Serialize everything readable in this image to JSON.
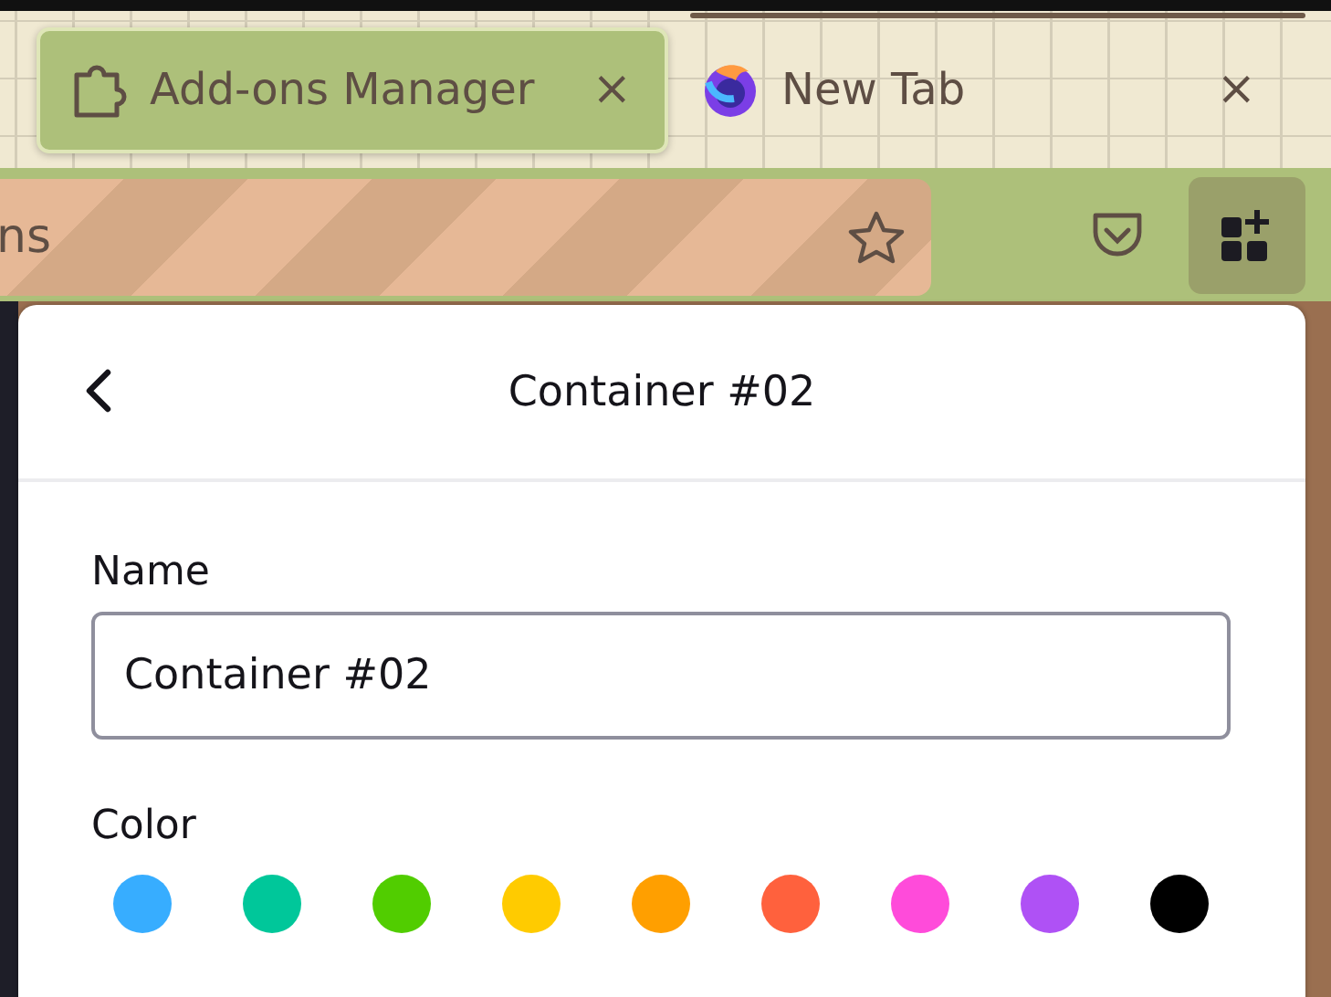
{
  "tabs": [
    {
      "label": "Add-ons Manager",
      "kind": "puzzle",
      "selected": true,
      "close": "×"
    },
    {
      "label": "New Tab",
      "kind": "browser",
      "selected": false,
      "close": "×"
    }
  ],
  "address_bar": {
    "value": "ns"
  },
  "panel": {
    "title": "Container #02",
    "name_label": "Name",
    "name_value": "Container #02",
    "color_label": "Color",
    "colors": [
      {
        "color": "#37adff",
        "selected": false
      },
      {
        "color": "#00c79a",
        "selected": false
      },
      {
        "color": "#51cd00",
        "selected": false
      },
      {
        "color": "#ffcb00",
        "selected": false
      },
      {
        "color": "#ff9f00",
        "selected": false
      },
      {
        "color": "#ff613d",
        "selected": false
      },
      {
        "color": "#ff4bda",
        "selected": false
      },
      {
        "color": "#af51f5",
        "selected": false
      },
      {
        "color": "#000000",
        "selected": false
      }
    ]
  }
}
